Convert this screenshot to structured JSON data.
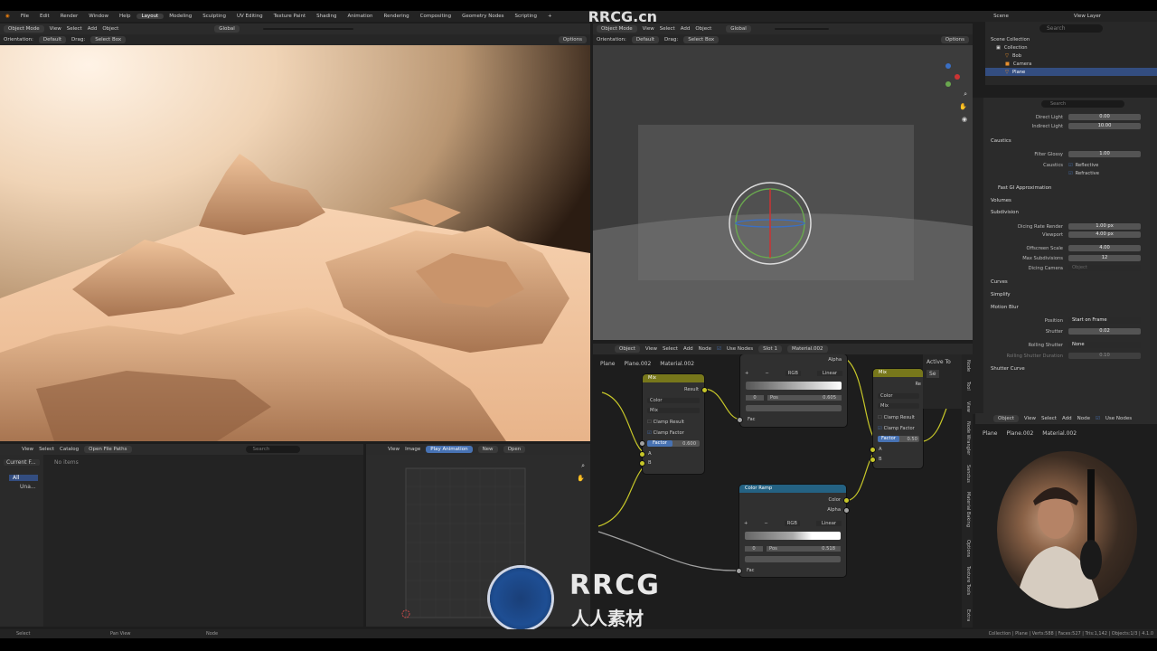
{
  "menu": {
    "items": [
      "File",
      "Edit",
      "Render",
      "Window",
      "Help"
    ]
  },
  "workspaces": {
    "tabs": [
      "Layout",
      "Modeling",
      "Sculpting",
      "UV Editing",
      "Texture Paint",
      "Shading",
      "Animation",
      "Rendering",
      "Compositing",
      "Geometry Nodes",
      "Scripting"
    ],
    "active": "Layout",
    "add": "+"
  },
  "scene": {
    "label": "Scene",
    "view_layer": "View Layer"
  },
  "watermark": {
    "top": "RRCG.cn",
    "brand": "RRCG",
    "sub": "人人素材"
  },
  "left_viewport": {
    "mode": "Object Mode",
    "menus": [
      "View",
      "Select",
      "Add",
      "Object"
    ],
    "transform": "Global",
    "orientation_label": "Orientation:",
    "orientation": "Default",
    "drag_label": "Drag:",
    "drag": "Select Box",
    "options": "Options"
  },
  "right_viewport": {
    "mode": "Object Mode",
    "menus": [
      "View",
      "Select",
      "Add",
      "Object"
    ],
    "transform": "Global",
    "orientation_label": "Orientation:",
    "orientation": "Default",
    "drag_label": "Drag:",
    "drag": "Select Box",
    "options": "Options"
  },
  "outliner": {
    "search_placeholder": "Search",
    "root": "Scene Collection",
    "collection": "Collection",
    "items": [
      "Bob",
      "Camera",
      "Plane"
    ]
  },
  "properties": {
    "search_placeholder": "Search",
    "direct_light": {
      "label": "Direct Light",
      "value": "0.00"
    },
    "indirect_light": {
      "label": "Indirect Light",
      "value": "10.00"
    },
    "caustics_section": "Caustics",
    "filter_glossy": {
      "label": "Filter Glossy",
      "value": "1.00"
    },
    "caustics": {
      "label": "Caustics",
      "reflective": "Reflective",
      "refractive": "Refractive"
    },
    "fast_gi": "Fast GI Approximation",
    "volumes": "Volumes",
    "subdivision": "Subdivision",
    "dicing_render": {
      "label": "Dicing Rate Render",
      "value": "1.00 px"
    },
    "viewport": {
      "label": "Viewport",
      "value": "4.00 px"
    },
    "offscreen": {
      "label": "Offscreen Scale",
      "value": "4.00"
    },
    "max_subdiv": {
      "label": "Max Subdivisions",
      "value": "12"
    },
    "dicing_camera": {
      "label": "Dicing Camera",
      "placeholder": "Object"
    },
    "curves": "Curves",
    "simplify": "Simplify",
    "motion_blur": "Motion Blur",
    "position": {
      "label": "Position",
      "value": "Start on Frame"
    },
    "shutter": {
      "label": "Shutter",
      "value": "0.02"
    },
    "rolling_shutter": {
      "label": "Rolling Shutter",
      "value": "None"
    },
    "rolling_duration": {
      "label": "Rolling Shutter Duration",
      "value": "0.10"
    },
    "shutter_curve": "Shutter Curve"
  },
  "file_browser": {
    "menus": [
      "View",
      "Select",
      "Catalog"
    ],
    "open_paths": "Open File Paths",
    "search_placeholder": "Search",
    "current": "Current F...",
    "all": "All",
    "unassigned": "Una...",
    "no_items": "No items"
  },
  "image_editor": {
    "menus": [
      "View",
      "Image"
    ],
    "play": "Play Animation",
    "new": "New",
    "open": "Open"
  },
  "node_editor_top": {
    "object": "Object",
    "menus": [
      "View",
      "Select",
      "Add",
      "Node"
    ],
    "use_nodes": "Use Nodes",
    "slot": "Slot 1",
    "material": "Material.002",
    "breadcrumb": [
      "Plane",
      "Plane.002",
      "Material.002"
    ],
    "active_to": "Active To",
    "se": "Se"
  },
  "node_editor_bottom": {
    "object": "Object",
    "menus": [
      "View",
      "Select",
      "Add",
      "Node"
    ],
    "use_nodes": "Use Nodes",
    "breadcrumb": [
      "Plane",
      "Plane.002",
      "Material.002"
    ]
  },
  "nodes": {
    "mix1": {
      "title": "Mix",
      "result": "Result",
      "color": "Color",
      "blend": "Mix",
      "clamp_result": "Clamp Result",
      "clamp_factor": "Clamp Factor",
      "factor_label": "Factor",
      "factor": "0.600",
      "a": "A",
      "b": "B"
    },
    "mix2": {
      "title": "Mix",
      "result": "Re",
      "color": "Color",
      "blend": "Mix",
      "clamp_result": "Clamp Result",
      "clamp_factor": "Clamp Factor",
      "factor_label": "Factor",
      "factor": "0.50",
      "a": "A",
      "b": "B"
    },
    "ramp_top": {
      "alpha": "Alpha",
      "mode": "RGB",
      "interp": "Linear",
      "index": "0",
      "pos_label": "Pos",
      "pos": "0.605",
      "fac": "Fac"
    },
    "ramp": {
      "title": "Color Ramp",
      "color": "Color",
      "alpha": "Alpha",
      "mode": "RGB",
      "interp": "Linear",
      "index": "0",
      "pos_label": "Pos",
      "pos": "0.518",
      "fac": "Fac"
    }
  },
  "side_tabs": [
    "Node",
    "Tool",
    "View",
    "Node Wrangler",
    "Sanctus",
    "Material Baking",
    "Options",
    "Texture Tools",
    "Extra"
  ],
  "status": {
    "select": "Select",
    "pan": "Pan View",
    "node": "Node",
    "info": "Collection | Plane | Verts:588 | Faces:527 | Tris:1,142 | Objects:1/3 | 4.1.0"
  },
  "colors": {
    "accent": "#4772b3",
    "node_mix_header": "#77771b",
    "node_ramp_header": "#246283",
    "socket_yellow": "#c7c729"
  }
}
